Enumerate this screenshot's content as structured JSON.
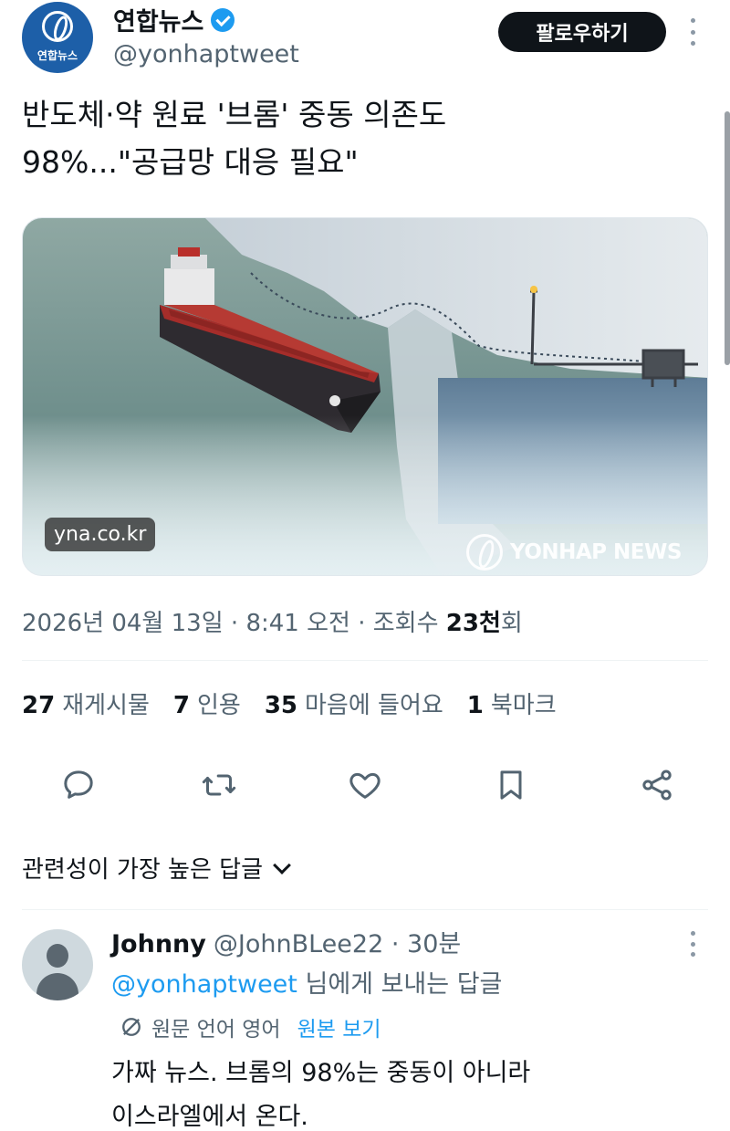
{
  "account": {
    "display_name": "연합뉴스",
    "handle": "@yonhaptweet",
    "avatar_text": "연합뉴스",
    "follow_label": "팔로우하기"
  },
  "tweet": {
    "text_line1": "반도체·약 원료 '브롬' 중동 의존도",
    "text_line2": "98%...\"공급망 대응 필요\"",
    "media": {
      "badge": "yna.co.kr",
      "watermark": "YONHAP NEWS"
    },
    "date": "2026년 04월 13일",
    "time": "8:41 오전",
    "views_label": "조회수",
    "views_count": "23천",
    "views_suffix": "회"
  },
  "stats": [
    {
      "count": "27",
      "label": "재게시물"
    },
    {
      "count": "7",
      "label": "인용"
    },
    {
      "count": "35",
      "label": "마음에 들어요"
    },
    {
      "count": "1",
      "label": "북마크"
    }
  ],
  "sort": {
    "label": "관련성이 가장 높은 답글"
  },
  "reply": {
    "name": "Johnny",
    "handle": "@JohnBLee22",
    "time": "30분",
    "reply_to_mention": "@yonhaptweet",
    "reply_to_suffix": "님에게 보내는 답글",
    "translate_info": "원문 언어 영어",
    "translate_link": "원본 보기",
    "text_line1": "가짜 뉴스. 브롬의 98%는 중동이 아니라",
    "text_line2": "이스라엘에서 온다."
  },
  "colors": {
    "accent": "#1d9bf0",
    "text_primary": "#0f1419",
    "text_secondary": "#536471",
    "follow_bg": "#0f1419",
    "brand_blue": "#1d5fa8"
  },
  "icons": [
    "reply-icon",
    "retweet-icon",
    "like-icon",
    "bookmark-icon",
    "share-icon",
    "verified-badge-icon",
    "translate-icon",
    "more-icon"
  ]
}
